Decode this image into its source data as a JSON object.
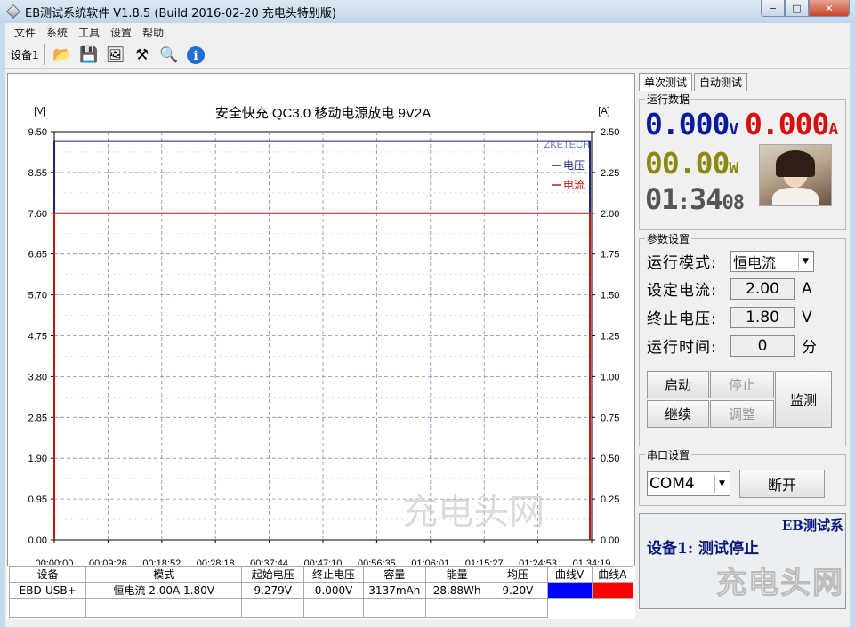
{
  "window": {
    "title": "EB测试系统软件 V1.8.5 (Build 2016-02-20 充电头特别版)",
    "controls": {
      "minimize": "−",
      "maximize": "□",
      "close": "✕"
    }
  },
  "menu": [
    "文件",
    "系统",
    "工具",
    "设置",
    "帮助"
  ],
  "toolbar": {
    "device_tab": "设备1",
    "tools": [
      {
        "icon": "open-folder-icon",
        "glyph": "📂"
      },
      {
        "icon": "save-icon",
        "glyph": "💾"
      },
      {
        "icon": "image-icon",
        "glyph": "🖼"
      },
      {
        "icon": "tools-icon",
        "glyph": "⚒"
      },
      {
        "icon": "search-icon",
        "glyph": "🔍"
      },
      {
        "icon": "info-icon",
        "glyph": "ℹ"
      }
    ]
  },
  "chart_data": {
    "type": "line",
    "title": "安全快充 QC3.0 移动电源放电 9V2A",
    "ylabel_left": "[V]",
    "ylabel_right": "[A]",
    "watermark": "ZKETECH",
    "y_left_ticks": [
      "9.50",
      "8.55",
      "7.60",
      "6.65",
      "5.70",
      "4.75",
      "3.80",
      "2.85",
      "1.90",
      "0.95",
      "0.00"
    ],
    "y_right_ticks": [
      "2.50",
      "2.25",
      "2.00",
      "1.75",
      "1.50",
      "1.25",
      "1.00",
      "0.75",
      "0.50",
      "0.25",
      "0.00"
    ],
    "x_ticks": [
      "00:00:00",
      "00:09:26",
      "00:18:52",
      "00:28:18",
      "00:37:44",
      "00:47:10",
      "00:56:35",
      "01:06:01",
      "01:15:27",
      "01:24:53",
      "01:34:19"
    ],
    "ylim_left": [
      0,
      9.5
    ],
    "ylim_right": [
      0,
      2.5
    ],
    "xlim_minutes": [
      0,
      94.32
    ],
    "series": [
      {
        "name": "电压",
        "axis": "left",
        "color": "#1a237e",
        "points": [
          [
            0,
            0
          ],
          [
            0,
            9.28
          ],
          [
            94.0,
            9.28
          ],
          [
            94.0,
            0
          ]
        ]
      },
      {
        "name": "电流",
        "axis": "right",
        "color": "#cc1111",
        "points": [
          [
            0,
            0
          ],
          [
            0,
            2.0
          ],
          [
            94.0,
            2.0
          ],
          [
            94.0,
            0
          ]
        ]
      }
    ],
    "grid": true,
    "legend_position": "top-right"
  },
  "summary_table": {
    "headers": [
      "设备",
      "模式",
      "起始电压",
      "终止电压",
      "容量",
      "能量",
      "均压",
      "曲线V",
      "曲线A"
    ],
    "row": [
      "EBD-USB+",
      "恒电流  2.00A  1.80V",
      "9.279V",
      "0.000V",
      "3137mAh",
      "28.88Wh",
      "9.20V",
      "",
      ""
    ],
    "curve_v_color": "#0000ff",
    "curve_a_color": "#ff0000"
  },
  "tabs": [
    "单次测试",
    "自动测试"
  ],
  "run_data": {
    "title": "运行数据",
    "voltage": "0.000",
    "voltage_unit": "V",
    "current": "0.000",
    "current_unit": "A",
    "power": "00.00",
    "power_unit": "W",
    "time_h": "01",
    "time_m": "34",
    "time_s": "08",
    "colors": {
      "voltage": "#0a1a9c",
      "current": "#d41010",
      "power": "#8c8a10",
      "time": "#555555"
    }
  },
  "params": {
    "title": "参数设置",
    "mode_label": "运行模式:",
    "mode_value": "恒电流",
    "current_label": "设定电流:",
    "current_value": "2.00",
    "current_unit": "A",
    "voltage_label": "终止电压:",
    "voltage_value": "1.80",
    "voltage_unit": "V",
    "time_label": "运行时间:",
    "time_value": "0",
    "time_unit": "分",
    "buttons": {
      "start": "启动",
      "stop": "停止",
      "monitor": "监测",
      "continue": "继续",
      "adjust": "调整"
    }
  },
  "serial": {
    "title": "串口设置",
    "port": "COM4",
    "disconnect": "断开"
  },
  "status": {
    "system_name": "EB测试系",
    "message": "设备1: 测试停止"
  },
  "watermark": "充电头网"
}
